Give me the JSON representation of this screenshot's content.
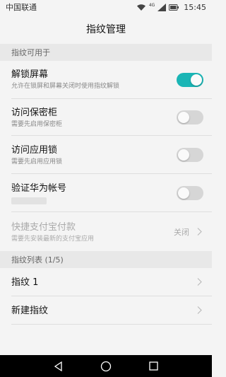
{
  "status": {
    "carrier": "中国联通",
    "network": "4G",
    "time": "15:45"
  },
  "header": {
    "title": "指纹管理"
  },
  "section_usage": {
    "label": "指纹可用于"
  },
  "items": [
    {
      "title": "解锁屏幕",
      "subtitle": "允许在锁屏和屏幕关闭时使用指纹解锁",
      "toggle": true
    },
    {
      "title": "访问保密柜",
      "subtitle": "需要先启用保密柜",
      "toggle": false
    },
    {
      "title": "访问应用锁",
      "subtitle": "需要先启用应用锁",
      "toggle": false
    },
    {
      "title": "验证华为帐号",
      "toggle": false
    },
    {
      "title": "快捷支付宝付款",
      "subtitle": "需要先安装最新的支付宝应用",
      "value": "关闭",
      "enabled": false
    }
  ],
  "section_list": {
    "label": "指纹列表 (1/5)"
  },
  "fingerprints": [
    {
      "title": "指纹 1"
    },
    {
      "title": "新建指纹"
    }
  ],
  "colors": {
    "accent": "#1ab5b5",
    "background": "#f4f4f4",
    "section": "#e8e8e8"
  },
  "icons": [
    "wifi-icon",
    "signal-icon",
    "battery-icon",
    "chevron-right-icon",
    "back-icon",
    "home-icon",
    "recents-icon"
  ]
}
